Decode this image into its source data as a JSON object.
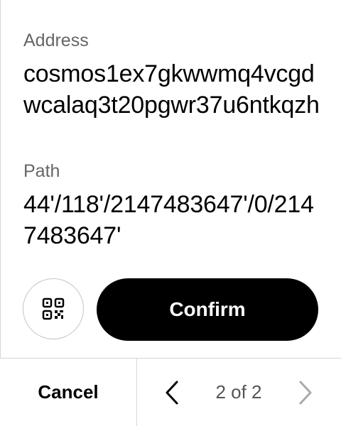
{
  "address": {
    "label": "Address",
    "value": "cosmos1ex7gkwwmq4vcgdwcalaq3t20pgwr37u6ntkqzh"
  },
  "path": {
    "label": "Path",
    "value": "44'/118'/2147483647'/0/2147483647'"
  },
  "actions": {
    "qr_icon": "qr-code-icon",
    "confirm_label": "Confirm"
  },
  "footer": {
    "cancel_label": "Cancel",
    "prev_icon": "chevron-left-icon",
    "page_indicator": "2 of 2",
    "next_icon": "chevron-right-icon"
  },
  "colors": {
    "primary": "#000000",
    "label_gray": "#666666",
    "border_gray": "#d6d6d6",
    "disabled_gray": "#aaaaaa"
  }
}
